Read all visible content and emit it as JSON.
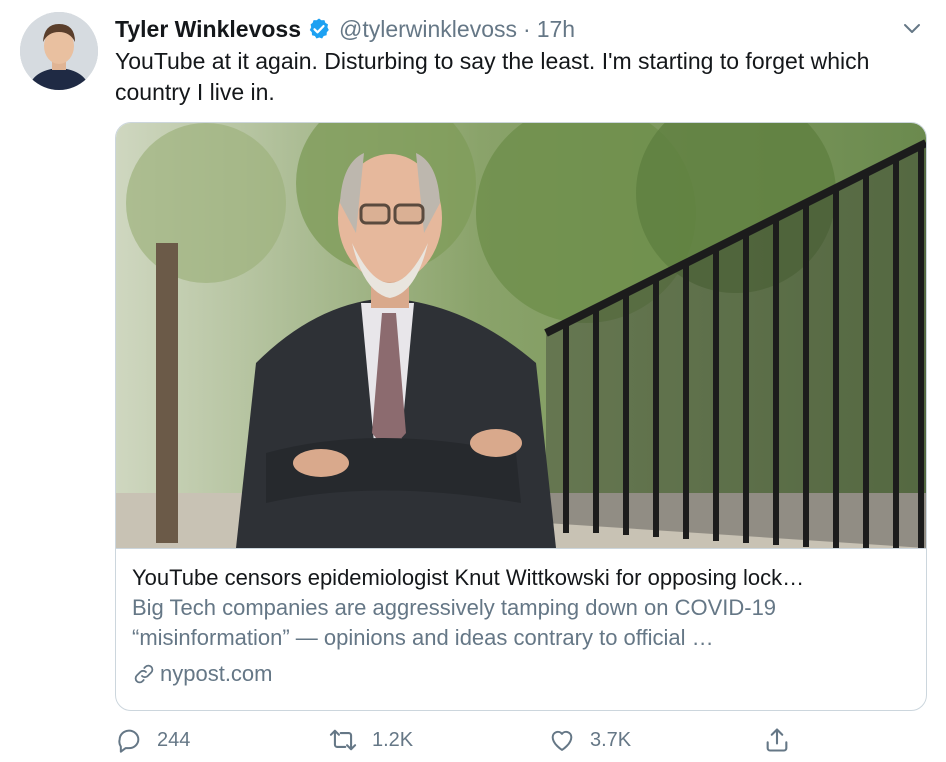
{
  "tweet": {
    "author_name": "Tyler Winklevoss",
    "handle": "@tylerwinklevoss",
    "separator": "·",
    "time": "17h",
    "text": "YouTube at it again. Disturbing to say the least. I'm starting to forget which country I live in."
  },
  "card": {
    "title": "YouTube censors epidemiologist Knut Wittkowski for opposing lock…",
    "description": "Big Tech companies are aggressively tamping down on COVID-19 “misinformation” — opinions and ideas contrary to official …",
    "source": "nypost.com"
  },
  "actions": {
    "reply_count": "244",
    "retweet_count": "1.2K",
    "like_count": "3.7K"
  },
  "icons": {
    "verified": "verified-badge-icon",
    "caret": "chevron-down-icon",
    "link": "link-icon",
    "reply": "reply-icon",
    "retweet": "retweet-icon",
    "like": "heart-icon",
    "share": "share-icon"
  },
  "colors": {
    "verified_blue": "#1da1f2",
    "secondary_text": "#657786",
    "border": "#ccd6dd"
  }
}
